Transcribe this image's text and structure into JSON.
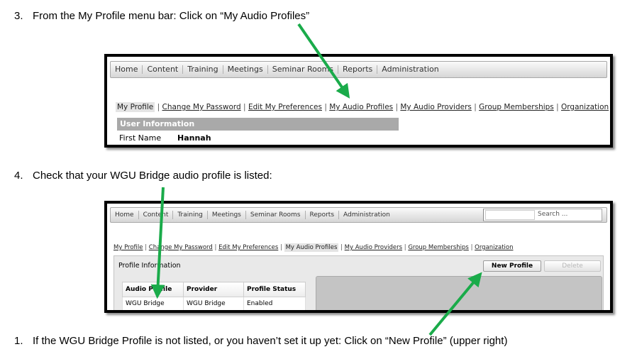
{
  "step3": {
    "num": "3.",
    "text": "From the My Profile menu bar: Click on “My Audio Profiles”"
  },
  "step4": {
    "num": "4.",
    "text": "Check that your WGU Bridge audio profile is listed:"
  },
  "step1": {
    "num": "1.",
    "text": "If the WGU Bridge Profile is not listed, or you haven’t set it up yet: Click on “New Profile” (upper right)"
  },
  "menu": [
    "Home",
    "Content",
    "Training",
    "Meetings",
    "Seminar Rooms",
    "Reports",
    "Administration"
  ],
  "subnav": [
    "My Profile",
    "Change My Password",
    "Edit My Preferences",
    "My Audio Profiles",
    "My Audio Providers",
    "Group Memberships",
    "Organization"
  ],
  "screenshot1": {
    "section_header": "User Information",
    "first_name_label": "First Name",
    "first_name_value": "Hannah"
  },
  "screenshot2": {
    "search_placeholder": "Search ...",
    "panel_title": "Profile Information",
    "new_profile_label": "New Profile",
    "delete_label": "Delete",
    "table": {
      "headers": [
        "Audio Profile",
        "Provider",
        "Profile Status"
      ],
      "rows": [
        [
          "WGU Bridge",
          "WGU Bridge",
          "Enabled"
        ]
      ]
    }
  },
  "colors": {
    "arrow": "#1aab4a",
    "header_bar": "#a9a9a9"
  }
}
